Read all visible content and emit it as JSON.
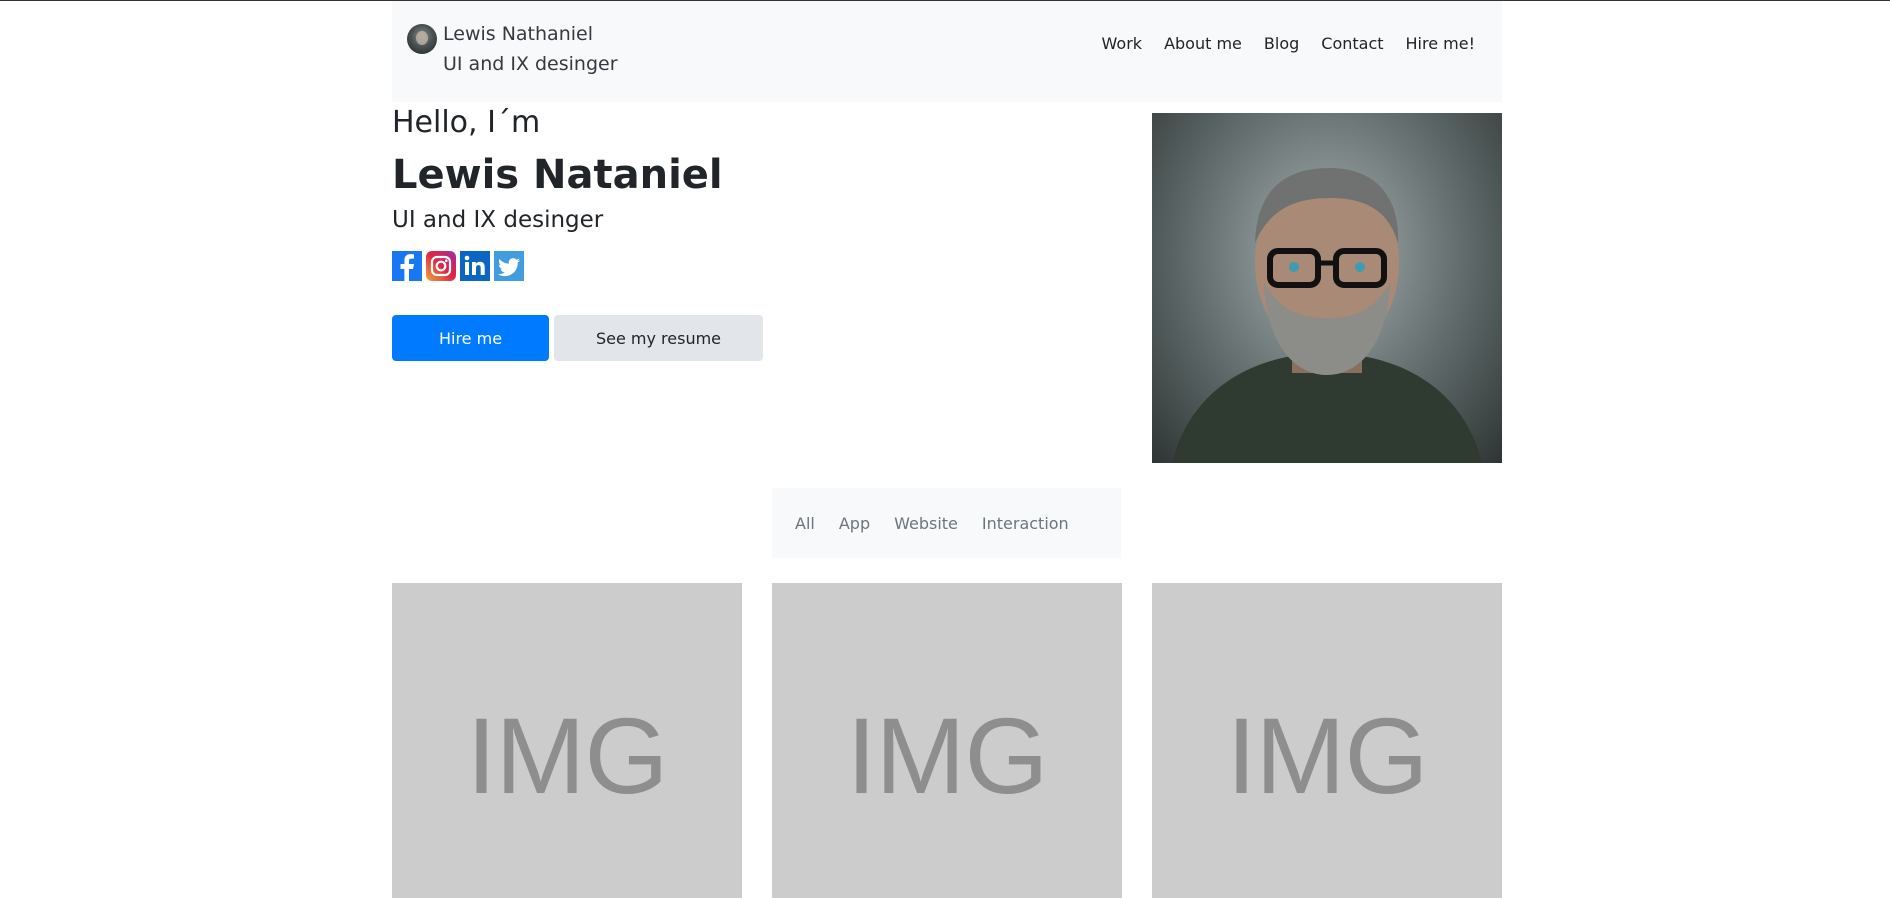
{
  "navbar": {
    "brand_name": "Lewis Nathaniel",
    "brand_role": "UI and IX desinger",
    "links": [
      "Work",
      "About me",
      "Blog",
      "Contact",
      "Hire me!"
    ]
  },
  "hero": {
    "greeting": "Hello, I´m",
    "name": "Lewis Nataniel",
    "role": "UI and IX desinger",
    "social_icons": [
      "facebook-icon",
      "instagram-icon",
      "linkedin-icon",
      "twitter-icon"
    ],
    "primary_button": "Hire me",
    "secondary_button": "See my resume"
  },
  "filter": {
    "items": [
      "All",
      "App",
      "Website",
      "Interaction"
    ]
  },
  "gallery": {
    "cards": [
      {
        "placeholder": "IMG"
      },
      {
        "placeholder": "IMG"
      },
      {
        "placeholder": "IMG"
      }
    ]
  },
  "colors": {
    "primary": "#007bff",
    "secondary_button": "#e2e6ea",
    "navbar_bg": "#f8f9fa",
    "placeholder_bg": "#cccccc"
  }
}
